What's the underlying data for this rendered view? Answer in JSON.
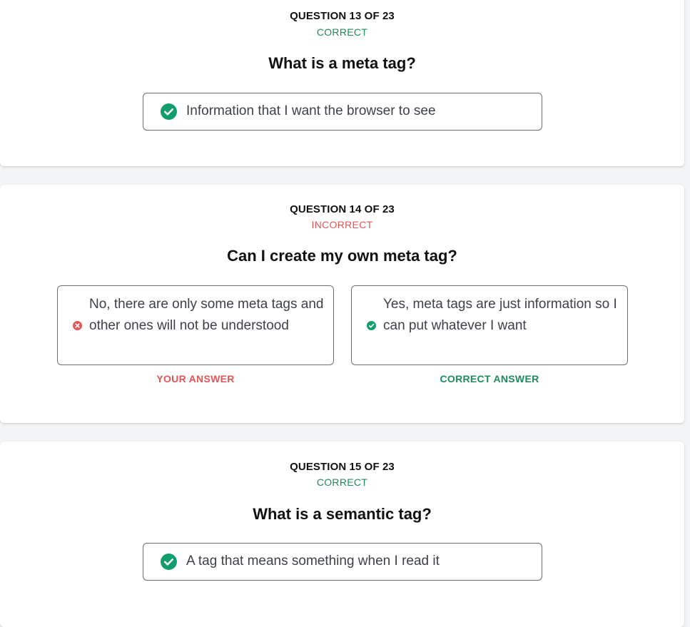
{
  "colors": {
    "correct": "#1f8a5b",
    "incorrect": "#e05656",
    "check_fill": "#129e6b",
    "x_fill": "#e05656"
  },
  "questions": [
    {
      "header": "QUESTION 13 OF 23",
      "status": "CORRECT",
      "title": "What is a meta tag?",
      "answer": {
        "icon": "check-circle-icon",
        "text": "Information that I want the browser to see"
      }
    },
    {
      "header": "QUESTION 14 OF 23",
      "status": "INCORRECT",
      "title": "Can I create my own meta tag?",
      "your_answer": {
        "icon": "x-circle-icon",
        "text": "No, there are only some meta tags and other ones will not be understood",
        "label": "YOUR ANSWER"
      },
      "correct_answer": {
        "icon": "check-circle-icon",
        "text": "Yes, meta tags are just information so I can put whatever I want",
        "label": "CORRECT ANSWER"
      }
    },
    {
      "header": "QUESTION 15 OF 23",
      "status": "CORRECT",
      "title": "What is a semantic tag?",
      "answer": {
        "icon": "check-circle-icon",
        "text": "A tag that means something when I read it"
      }
    }
  ]
}
